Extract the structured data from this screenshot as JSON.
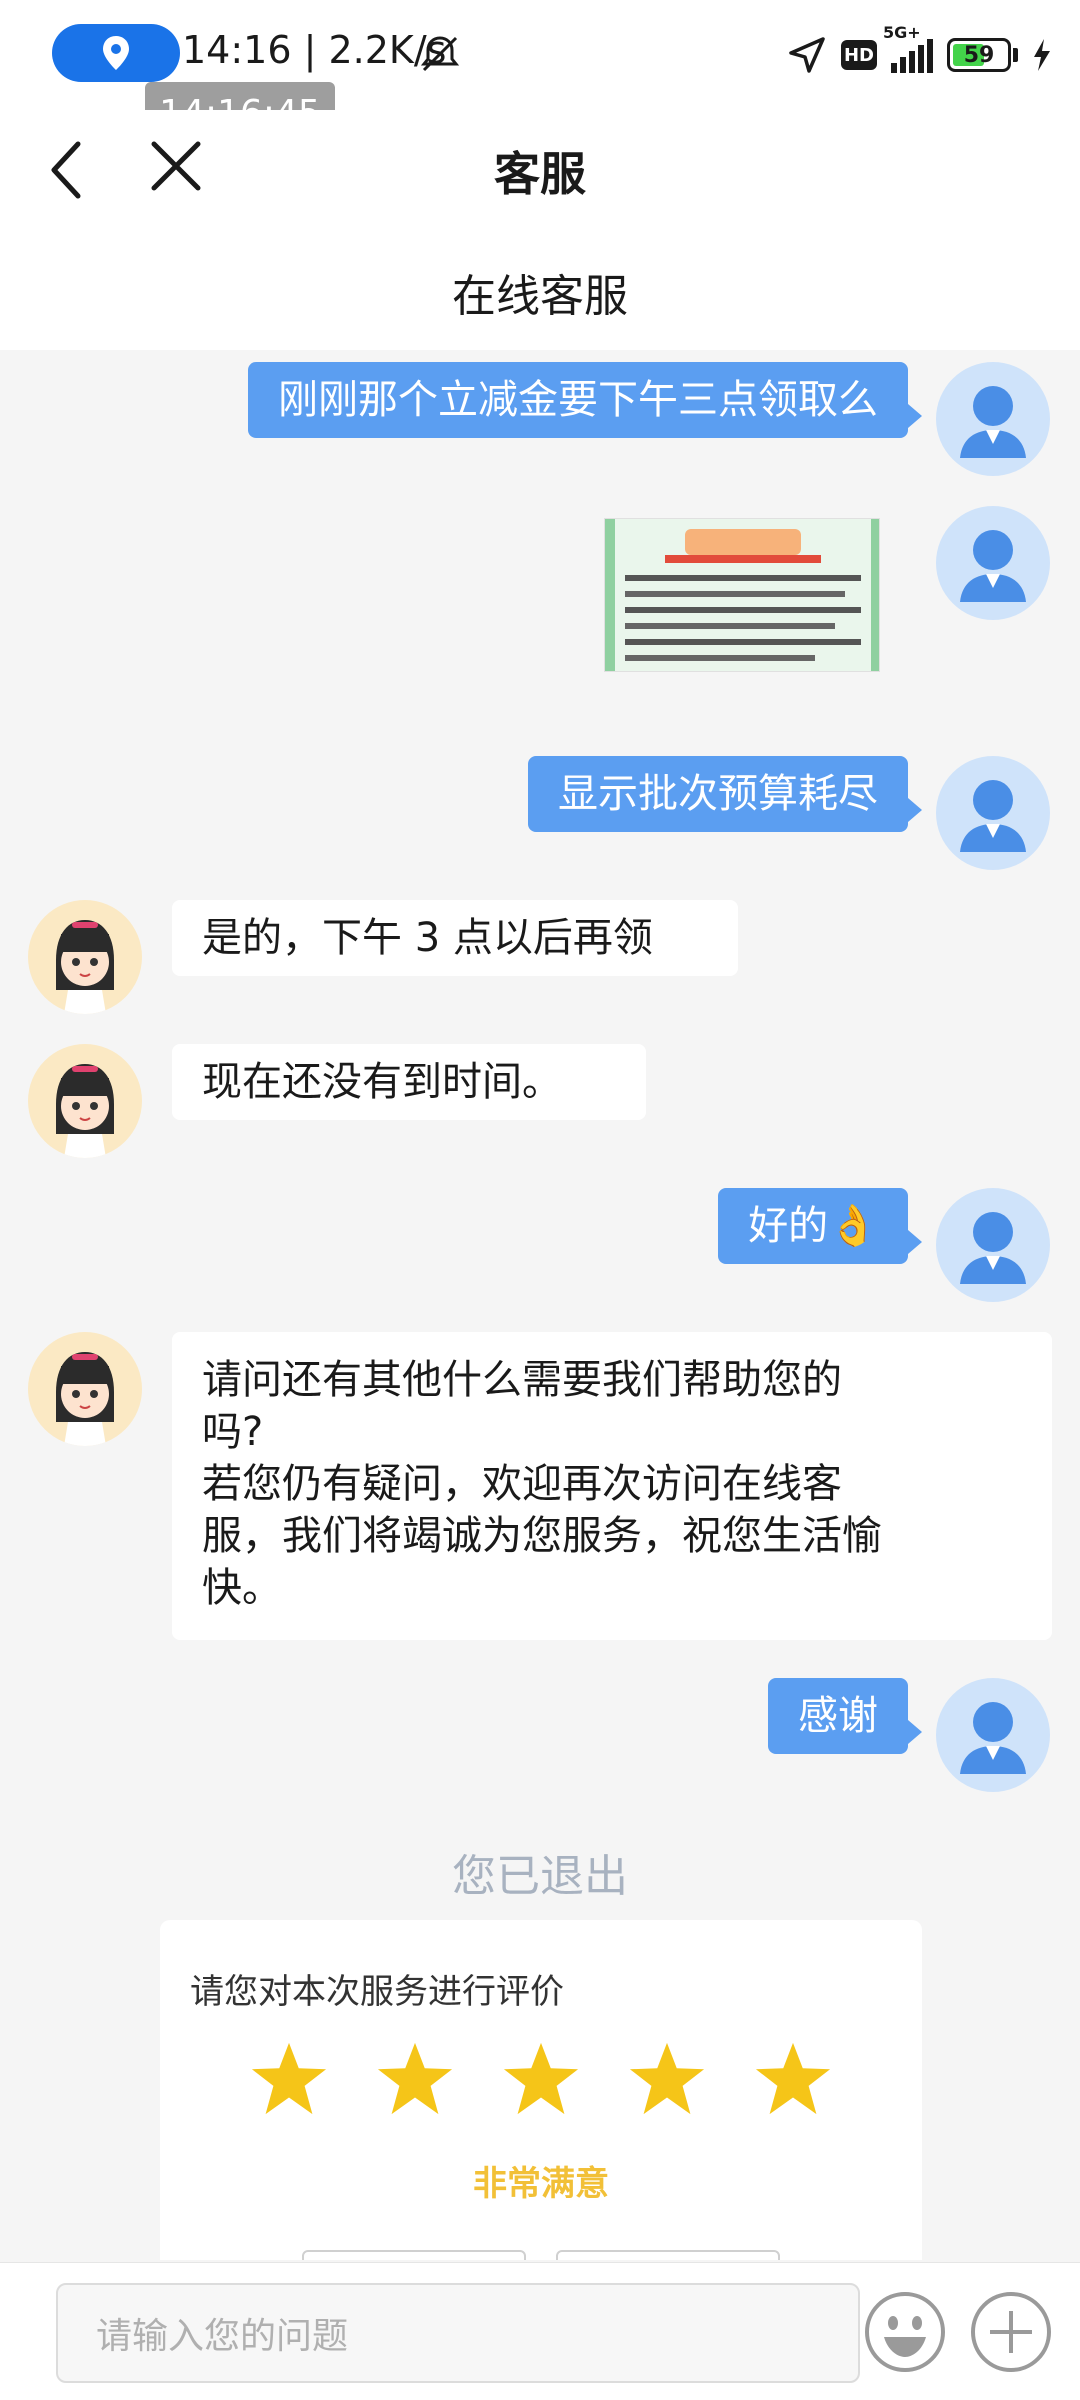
{
  "status_bar": {
    "time_speed": "14:16 | 2.2K/s",
    "time_tooltip": "14:16:45",
    "network_label": "5G+",
    "hd_label": "HD",
    "battery_level": "59",
    "battery_fraction": 0.59
  },
  "header": {
    "title": "客服",
    "subtitle": "在线客服"
  },
  "messages": [
    {
      "sender": "user",
      "text": "刚刚那个立减金要下午三点领取么"
    },
    {
      "sender": "user",
      "type": "image"
    },
    {
      "sender": "user",
      "text": "显示批次预算耗尽"
    },
    {
      "sender": "agent",
      "text": "是的，下午 3 点以后再领"
    },
    {
      "sender": "agent",
      "text": "现在还没有到时间。"
    },
    {
      "sender": "user",
      "text": "好的👌"
    },
    {
      "sender": "agent",
      "lines": [
        "请问还有其他什么需要我们帮助您的",
        "吗?",
        "若您仍有疑问，欢迎再次访问在线客",
        "服，我们将竭诚为您服务，祝您生活愉",
        "快。"
      ]
    },
    {
      "sender": "user",
      "text": "感谢"
    }
  ],
  "exit_notice": "您已退出",
  "rating": {
    "prompt": "请您对本次服务进行评价",
    "stars_selected": 5,
    "stars_total": 5,
    "level_label": "非常满意",
    "star_color": "#f5c518"
  },
  "input": {
    "placeholder": "请输入您的问题"
  },
  "colors": {
    "user_bubble": "#5b9ef1",
    "accent_blue": "#1a73e8",
    "rating_label": "#f2c037"
  },
  "icons": [
    "location-icon",
    "mute-icon",
    "navigation-icon",
    "signal-icon",
    "battery-icon",
    "charging-icon",
    "back-icon",
    "close-icon",
    "emoji-icon",
    "plus-icon"
  ]
}
